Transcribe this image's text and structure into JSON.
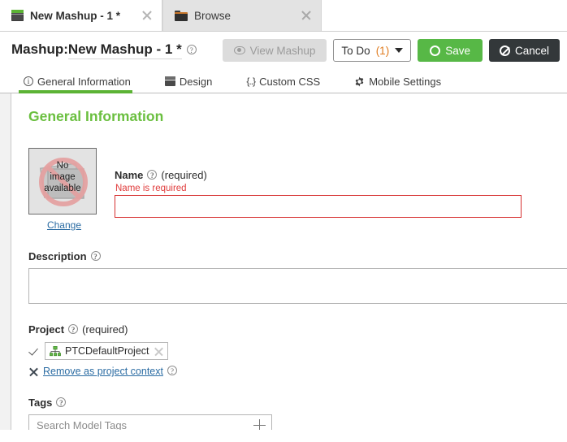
{
  "browser_tabs": [
    {
      "label": "New Mashup - 1 *",
      "icon": "mashup-icon",
      "active": true,
      "close": "×"
    },
    {
      "label": "Browse",
      "icon": "folder-icon",
      "active": false,
      "close": "×"
    }
  ],
  "header": {
    "title_prefix": "Mashup:",
    "title_value": "New Mashup - 1 *",
    "help": "?",
    "buttons": {
      "view_mashup": "View Mashup",
      "todo_label": "To Do",
      "todo_count": "(1)",
      "save": "Save",
      "cancel": "Cancel"
    }
  },
  "subtabs": [
    {
      "label": "General Information",
      "icon": "info-icon",
      "active": true
    },
    {
      "label": "Design",
      "icon": "design-icon",
      "active": false
    },
    {
      "label": "Custom CSS",
      "icon": "css-braces-icon",
      "active": false
    },
    {
      "label": "Mobile Settings",
      "icon": "gear-icon",
      "active": false
    }
  ],
  "content": {
    "section_title": "General Information",
    "thumbnail": {
      "line1": "No",
      "line2": "image",
      "line3": "available",
      "change_link": "Change"
    },
    "name": {
      "label": "Name",
      "help": "?",
      "required": "(required)",
      "error": "Name is required",
      "value": "",
      "placeholder": ""
    },
    "description": {
      "label": "Description",
      "help": "?",
      "value": "",
      "placeholder": ""
    },
    "project": {
      "label": "Project",
      "help": "?",
      "required": "(required)",
      "chip_label": "PTCDefaultProject",
      "chip_remove": "×",
      "remove_link": "Remove as project context",
      "remove_help": "?"
    },
    "tags": {
      "label": "Tags",
      "help": "?",
      "value": "",
      "placeholder": "Search Model Tags"
    }
  },
  "colors": {
    "accent_green": "#5cb335",
    "section_green": "#6abf3f",
    "save_green": "#57b846",
    "cancel_dark": "#33383a",
    "error_red": "#d62f2f",
    "link_blue": "#2b6ca3",
    "todo_orange": "#e07b1f"
  }
}
